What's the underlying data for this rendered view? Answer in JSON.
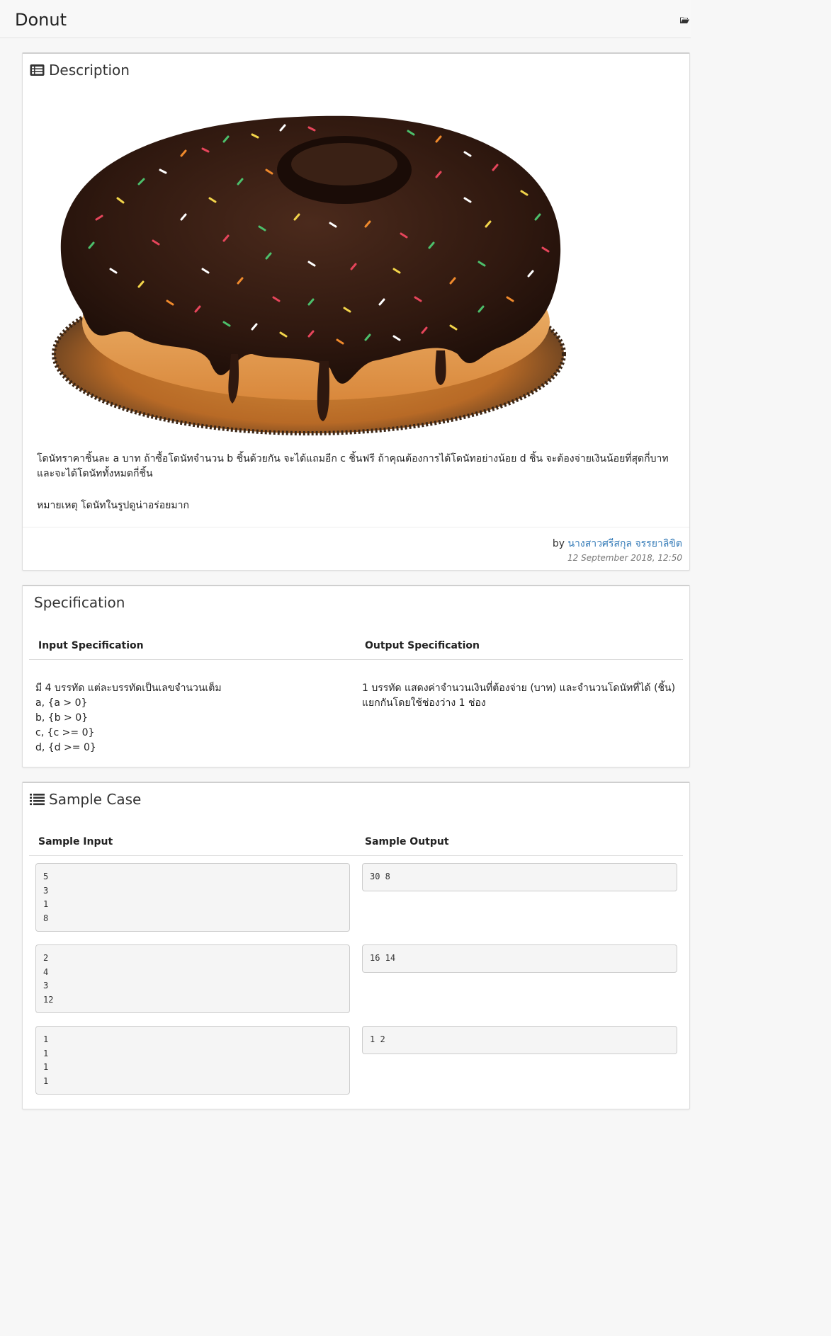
{
  "header": {
    "title": "Donut",
    "folder_icon": "folder-open-icon"
  },
  "description": {
    "heading": "Description",
    "heading_icon": "list-alt-icon",
    "image_subject": "chocolate glazed donut with rainbow sprinkles",
    "text": "โดนัทราคาชิ้นละ a บาท ถ้าซื้อโดนัทจำนวน b ชิ้นด้วยกัน จะได้แถมอีก c ชิ้นฟรี ถ้าคุณต้องการได้โดนัทอย่างน้อย d ชิ้น จะต้องจ่ายเงินน้อยที่สุดกี่บาท และจะได้โดนัททั้งหมดกี่ชิ้น",
    "note": "หมายเหตุ โดนัทในรูปดูน่าอร่อยมาก",
    "by_label": "by",
    "author": "นางสาวศรีสกุล จรรยาลิขิต",
    "timestamp": "12 September 2018, 12:50"
  },
  "specification": {
    "heading": "Specification",
    "input_header": "Input Specification",
    "output_header": "Output Specification",
    "input_lines": [
      "มี 4 บรรทัด แต่ละบรรทัดเป็นเลขจำนวนเต็ม",
      "a, {a > 0}",
      "b, {b > 0}",
      "c, {c >= 0}",
      "d, {d >= 0}"
    ],
    "output_lines": [
      "1 บรรทัด แสดงค่าจำนวนเงินที่ต้องจ่าย (บาท) และจำนวนโดนัทที่ได้ (ชิ้น)",
      "แยกกันโดยใช้ช่องว่าง 1 ช่อง"
    ]
  },
  "samples": {
    "heading": "Sample Case",
    "heading_icon": "list-icon",
    "input_header": "Sample Input",
    "output_header": "Sample Output",
    "cases": [
      {
        "input": [
          "5",
          "3",
          "1",
          "8"
        ],
        "output": [
          "30 8"
        ]
      },
      {
        "input": [
          "2",
          "4",
          "3",
          "12"
        ],
        "output": [
          "16 14"
        ]
      },
      {
        "input": [
          "1",
          "1",
          "1",
          "1"
        ],
        "output": [
          "1 2"
        ]
      }
    ]
  },
  "colors": {
    "link": "#337ab7",
    "panel_border": "#dddddd",
    "pre_background": "#f5f5f5"
  }
}
